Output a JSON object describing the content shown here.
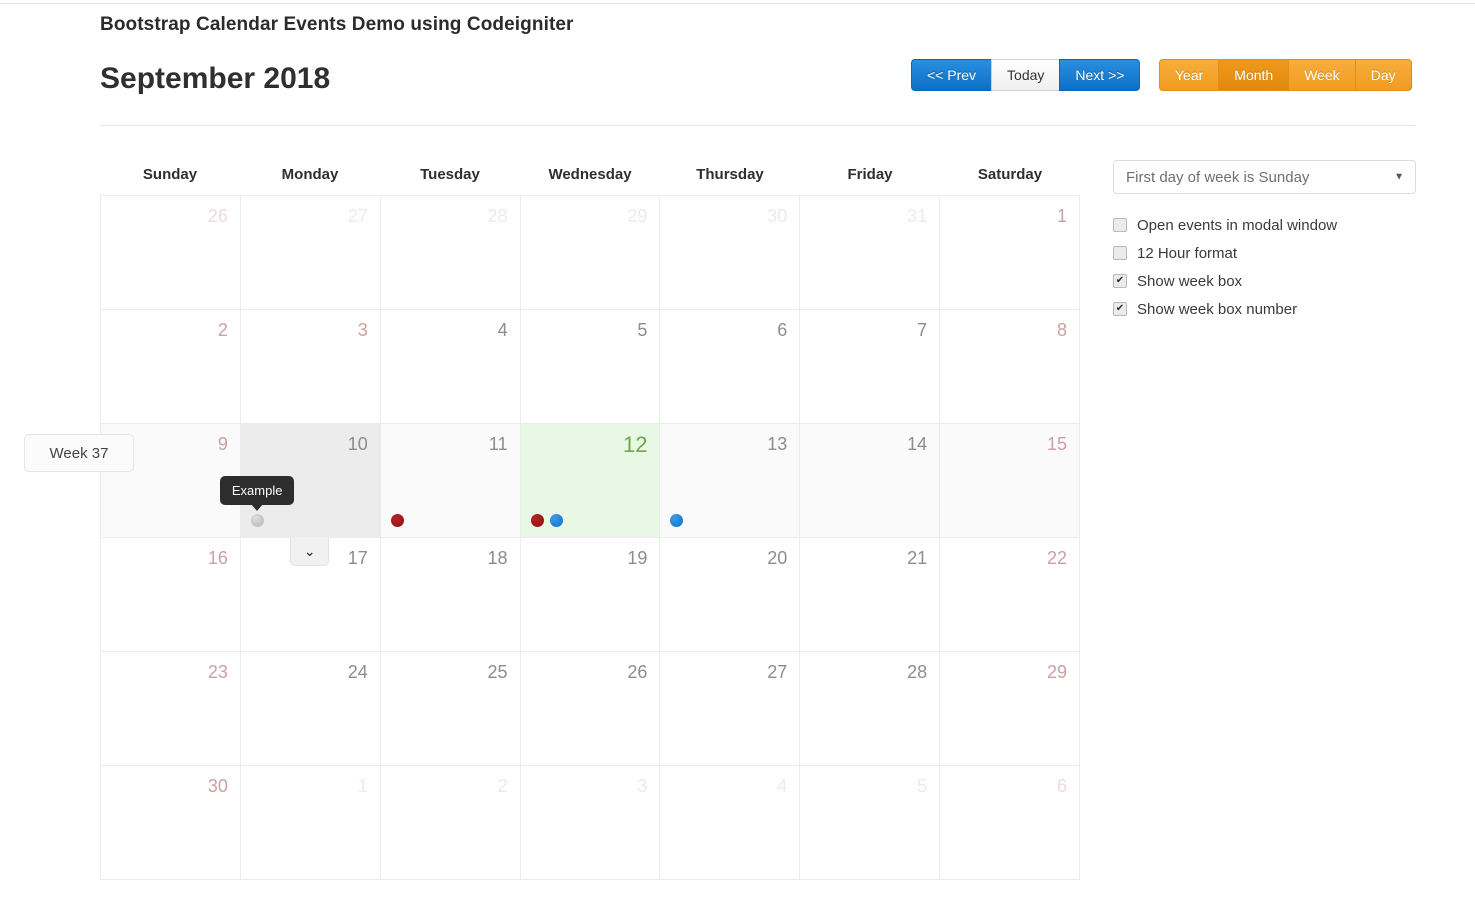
{
  "header": {
    "app_title": "Bootstrap Calendar Events Demo using Codeigniter",
    "month_title": "September 2018"
  },
  "nav": {
    "prev_label": "<< Prev",
    "today_label": "Today",
    "next_label": "Next >>"
  },
  "views": {
    "year_label": "Year",
    "month_label": "Month",
    "week_label": "Week",
    "day_label": "Day",
    "active": "Month"
  },
  "calendar": {
    "day_names": [
      "Sunday",
      "Monday",
      "Tuesday",
      "Wednesday",
      "Thursday",
      "Friday",
      "Saturday"
    ],
    "week_badge_label": "Week 37",
    "expander_glyph": "⌄",
    "weeks": [
      {
        "highlight": false,
        "days": [
          {
            "num": "26",
            "month": "other",
            "weekend": true
          },
          {
            "num": "27",
            "month": "other",
            "weekend": false
          },
          {
            "num": "28",
            "month": "other",
            "weekend": false
          },
          {
            "num": "29",
            "month": "other",
            "weekend": false
          },
          {
            "num": "30",
            "month": "other",
            "weekend": false
          },
          {
            "num": "31",
            "month": "other",
            "weekend": false
          },
          {
            "num": "1",
            "month": "current",
            "weekend": true
          }
        ]
      },
      {
        "highlight": false,
        "days": [
          {
            "num": "2",
            "month": "current",
            "weekend": true
          },
          {
            "num": "3",
            "month": "current",
            "weekend": true
          },
          {
            "num": "4",
            "month": "current",
            "weekend": false
          },
          {
            "num": "5",
            "month": "current",
            "weekend": false
          },
          {
            "num": "6",
            "month": "current",
            "weekend": false
          },
          {
            "num": "7",
            "month": "current",
            "weekend": false
          },
          {
            "num": "8",
            "month": "current",
            "weekend": true
          }
        ]
      },
      {
        "highlight": true,
        "days": [
          {
            "num": "9",
            "month": "current",
            "weekend": true
          },
          {
            "num": "10",
            "month": "current",
            "weekend": false,
            "hovered": true,
            "events": [
              {
                "color": "grey",
                "title": "Example",
                "tooltip": true
              }
            ]
          },
          {
            "num": "11",
            "month": "current",
            "weekend": false,
            "events": [
              {
                "color": "red"
              }
            ]
          },
          {
            "num": "12",
            "month": "current",
            "weekend": false,
            "today": true,
            "events": [
              {
                "color": "red"
              },
              {
                "color": "blue"
              }
            ]
          },
          {
            "num": "13",
            "month": "current",
            "weekend": false,
            "events": [
              {
                "color": "blue"
              }
            ]
          },
          {
            "num": "14",
            "month": "current",
            "weekend": false
          },
          {
            "num": "15",
            "month": "current",
            "weekend": true
          }
        ]
      },
      {
        "highlight": false,
        "days": [
          {
            "num": "16",
            "month": "current",
            "weekend": true
          },
          {
            "num": "17",
            "month": "current",
            "weekend": false
          },
          {
            "num": "18",
            "month": "current",
            "weekend": false
          },
          {
            "num": "19",
            "month": "current",
            "weekend": false
          },
          {
            "num": "20",
            "month": "current",
            "weekend": false
          },
          {
            "num": "21",
            "month": "current",
            "weekend": false
          },
          {
            "num": "22",
            "month": "current",
            "weekend": true
          }
        ]
      },
      {
        "highlight": false,
        "days": [
          {
            "num": "23",
            "month": "current",
            "weekend": true
          },
          {
            "num": "24",
            "month": "current",
            "weekend": false
          },
          {
            "num": "25",
            "month": "current",
            "weekend": false
          },
          {
            "num": "26",
            "month": "current",
            "weekend": false
          },
          {
            "num": "27",
            "month": "current",
            "weekend": false
          },
          {
            "num": "28",
            "month": "current",
            "weekend": false
          },
          {
            "num": "29",
            "month": "current",
            "weekend": true
          }
        ]
      },
      {
        "highlight": false,
        "days": [
          {
            "num": "30",
            "month": "current",
            "weekend": true
          },
          {
            "num": "1",
            "month": "other",
            "weekend": false
          },
          {
            "num": "2",
            "month": "other",
            "weekend": false
          },
          {
            "num": "3",
            "month": "other",
            "weekend": false
          },
          {
            "num": "4",
            "month": "other",
            "weekend": false
          },
          {
            "num": "5",
            "month": "other",
            "weekend": false
          },
          {
            "num": "6",
            "month": "other",
            "weekend": true
          }
        ]
      }
    ]
  },
  "sidebar": {
    "first_day_select": "First day of week is Sunday",
    "caret_glyph": "▼",
    "options": [
      {
        "label": "Open events in modal window",
        "checked": false
      },
      {
        "label": "12 Hour format",
        "checked": false
      },
      {
        "label": "Show week box",
        "checked": true
      },
      {
        "label": "Show week box number",
        "checked": true
      }
    ]
  },
  "colors": {
    "event_red": "#8a1212",
    "event_blue": "#0f72c6",
    "event_grey": "#b5b5b5",
    "today_bg": "#e9f8e5",
    "today_text": "#6aa84f",
    "primary_blue": "#0b6fc6",
    "accent_orange": "#f09c1f"
  }
}
